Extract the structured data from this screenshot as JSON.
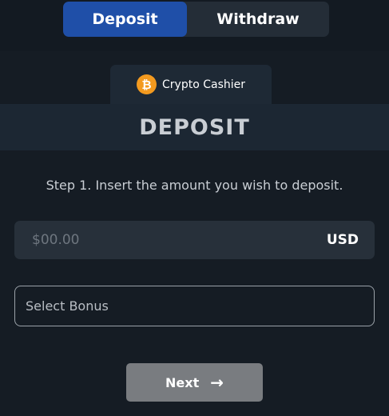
{
  "tabs": {
    "deposit_label": "Deposit",
    "withdraw_label": "Withdraw"
  },
  "cashier": {
    "tab_label": "Crypto Cashier",
    "icon": "bitcoin-icon",
    "icon_glyph": "₿"
  },
  "deposit": {
    "title": "DEPOSIT",
    "step_text": "Step 1. Insert the amount you wish to deposit.",
    "amount_placeholder": "$00.00",
    "amount_value": "",
    "currency": "USD",
    "bonus_placeholder": "Select Bonus",
    "next_label": "Next",
    "next_icon": "arrow-right-icon"
  },
  "colors": {
    "background": "#151c24",
    "active_tab": "#1f4fa8",
    "bitcoin": "#f39a1f",
    "next_button": "#797c80"
  }
}
